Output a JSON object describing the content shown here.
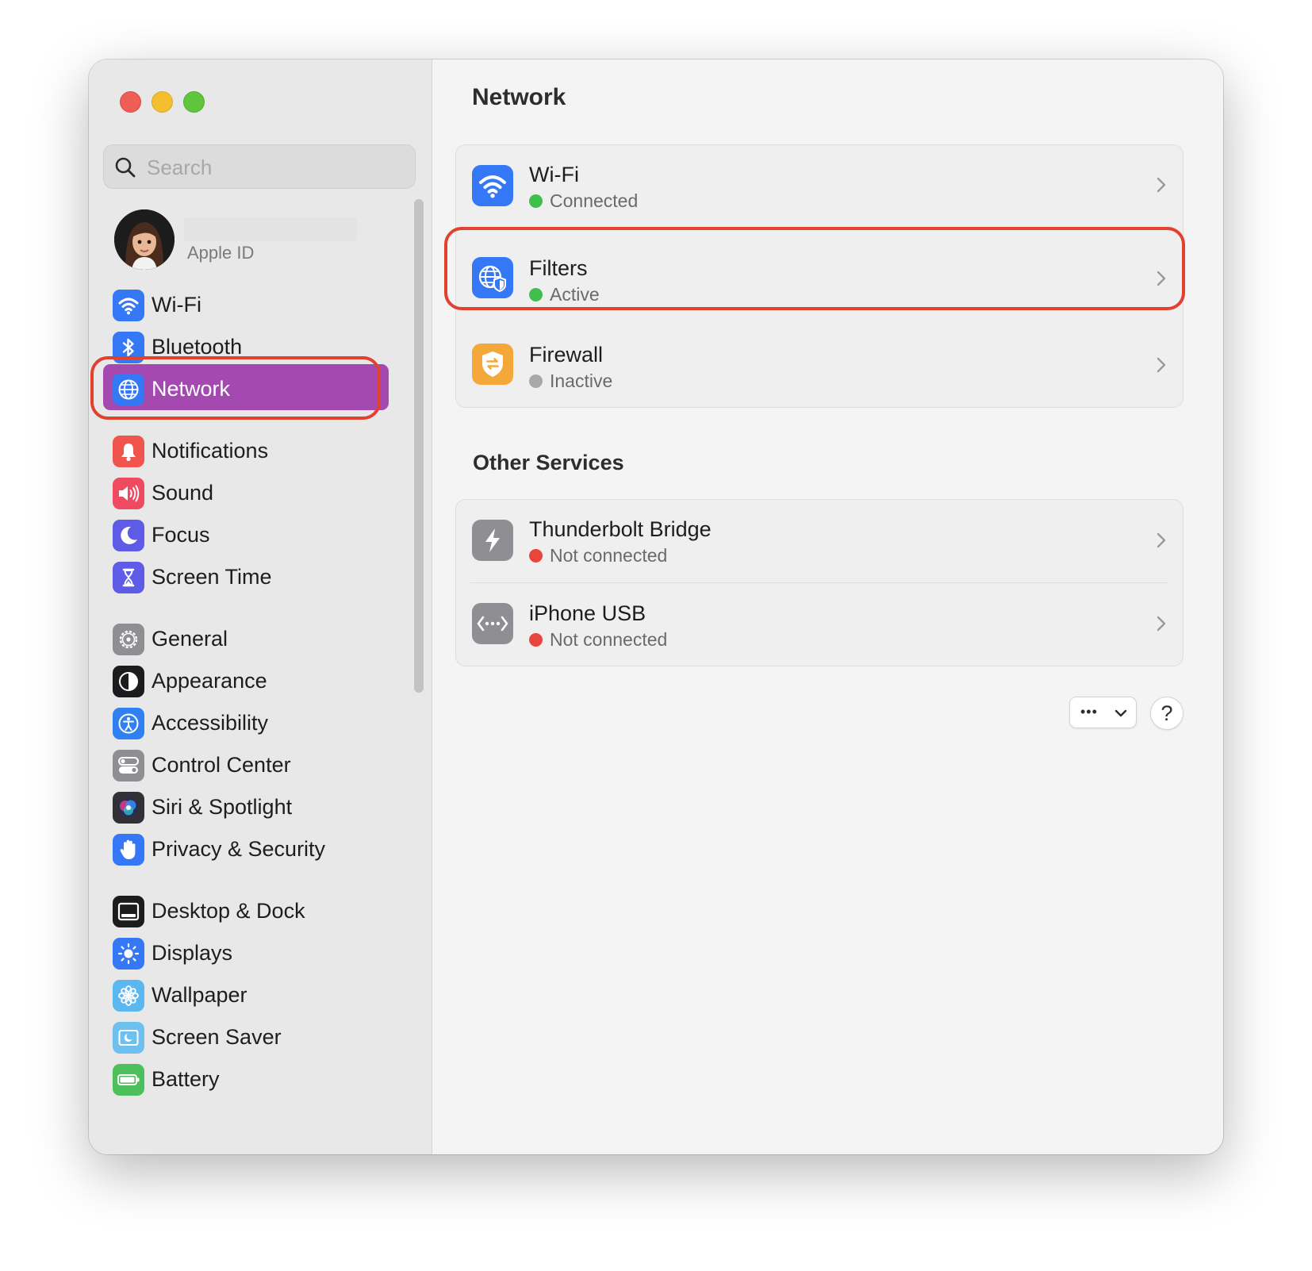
{
  "window": {
    "search": {
      "placeholder": "Search",
      "value": ""
    },
    "account": {
      "subtitle": "Apple ID"
    }
  },
  "sidebar": {
    "items": [
      {
        "label": "Wi-Fi",
        "icon": "wifi-icon",
        "color": "#3478f6"
      },
      {
        "label": "Bluetooth",
        "icon": "bluetooth-icon",
        "color": "#3478f6"
      },
      {
        "label": "Network",
        "icon": "globe-icon",
        "color": "#3478f6",
        "selected": true
      },
      {
        "label": "Notifications",
        "icon": "bell-icon",
        "color": "#f0544c"
      },
      {
        "label": "Sound",
        "icon": "speaker-icon",
        "color": "#ef4a60"
      },
      {
        "label": "Focus",
        "icon": "moon-icon",
        "color": "#5e5ce6"
      },
      {
        "label": "Screen Time",
        "icon": "hourglass-icon",
        "color": "#5e5ce6"
      },
      {
        "label": "General",
        "icon": "gear-icon",
        "color": "#8e8e93"
      },
      {
        "label": "Appearance",
        "icon": "appearance-icon",
        "color": "#1c1c1e"
      },
      {
        "label": "Accessibility",
        "icon": "accessibility-icon",
        "color": "#2f80f0"
      },
      {
        "label": "Control Center",
        "icon": "control-center-icon",
        "color": "#8e8e93"
      },
      {
        "label": "Siri & Spotlight",
        "icon": "siri-icon",
        "color": "#303036"
      },
      {
        "label": "Privacy & Security",
        "icon": "hand-icon",
        "color": "#3478f6"
      },
      {
        "label": "Desktop & Dock",
        "icon": "dock-icon",
        "color": "#1c1c1e"
      },
      {
        "label": "Displays",
        "icon": "sun-icon",
        "color": "#3478f6"
      },
      {
        "label": "Wallpaper",
        "icon": "flower-icon",
        "color": "#5ab7f0"
      },
      {
        "label": "Screen Saver",
        "icon": "screen-saver-icon",
        "color": "#6ec1ee"
      },
      {
        "label": "Battery",
        "icon": "battery-icon",
        "color": "#4cc05a"
      }
    ]
  },
  "main": {
    "title": "Network",
    "services": [
      {
        "name": "Wi-Fi",
        "status": "Connected",
        "status_color": "#3fbf4b",
        "icon": "wifi-icon",
        "color": "#3478f6"
      },
      {
        "name": "Filters",
        "status": "Active",
        "status_color": "#3fbf4b",
        "icon": "globe-shield-icon",
        "color": "#3478f6"
      },
      {
        "name": "Firewall",
        "status": "Inactive",
        "status_color": "#a8a8a8",
        "icon": "firewall-shield-icon",
        "color": "#f5a83a"
      }
    ],
    "other_services_title": "Other Services",
    "other_services": [
      {
        "name": "Thunderbolt Bridge",
        "status": "Not connected",
        "status_color": "#e8453c",
        "icon": "thunderbolt-icon",
        "color": "#8e8e93"
      },
      {
        "name": "iPhone USB",
        "status": "Not connected",
        "status_color": "#e8453c",
        "icon": "usb-dots-icon",
        "color": "#8e8e93"
      }
    ],
    "more_button": {
      "label": "•••"
    },
    "help_button": {
      "label": "?"
    }
  }
}
